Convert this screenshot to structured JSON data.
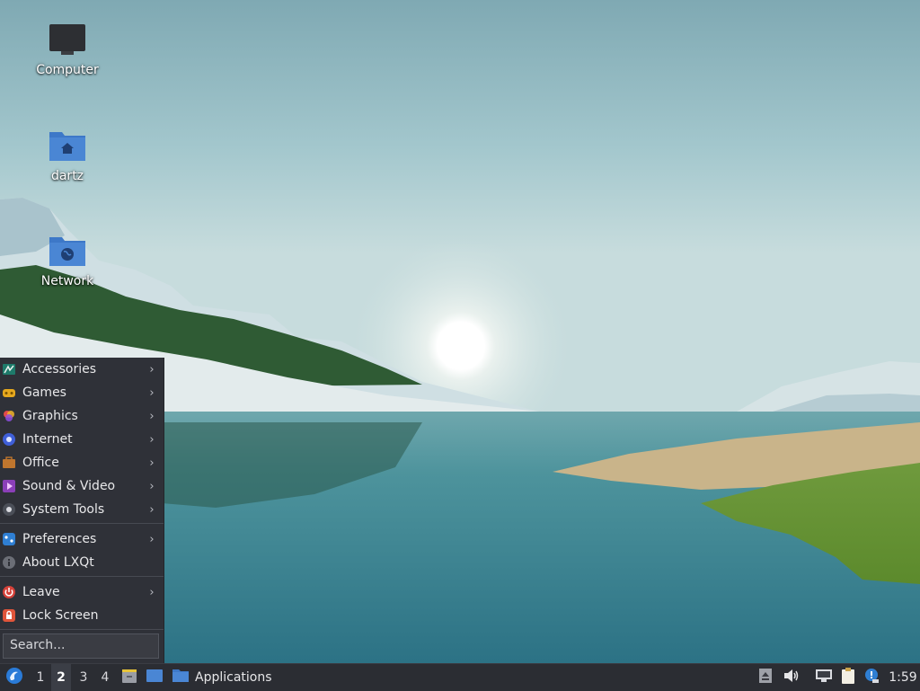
{
  "desktop": {
    "icons": [
      {
        "label": "Computer",
        "icon": "monitor-icon"
      },
      {
        "label": "dartz",
        "icon": "home-folder-icon"
      },
      {
        "label": "Network",
        "icon": "network-folder-icon"
      }
    ]
  },
  "menu": {
    "items": [
      {
        "label": "Accessories",
        "icon": "accessories-icon",
        "submenu": true
      },
      {
        "label": "Games",
        "icon": "games-icon",
        "submenu": true
      },
      {
        "label": "Graphics",
        "icon": "graphics-icon",
        "submenu": true
      },
      {
        "label": "Internet",
        "icon": "internet-icon",
        "submenu": true
      },
      {
        "label": "Office",
        "icon": "office-icon",
        "submenu": true
      },
      {
        "label": "Sound & Video",
        "icon": "sound-video-icon",
        "submenu": true
      },
      {
        "label": "System Tools",
        "icon": "system-tools-icon",
        "submenu": true
      },
      {
        "label": "Preferences",
        "icon": "preferences-icon",
        "submenu": true
      },
      {
        "label": "About LXQt",
        "icon": "info-icon",
        "submenu": false
      },
      {
        "label": "Leave",
        "icon": "power-icon",
        "submenu": true
      },
      {
        "label": "Lock Screen",
        "icon": "lock-icon",
        "submenu": false
      }
    ],
    "arrow": "›",
    "search_placeholder": "Search..."
  },
  "taskbar": {
    "workspaces": [
      "1",
      "2",
      "3",
      "4"
    ],
    "active_workspace": "2",
    "task_label": "Applications",
    "clock": "1:59"
  },
  "colors": {
    "menu_bg": "#2f3138",
    "taskbar_bg": "#2b2d33",
    "folder_blue": "#4a86d4",
    "accent": "#3a7bd5"
  }
}
